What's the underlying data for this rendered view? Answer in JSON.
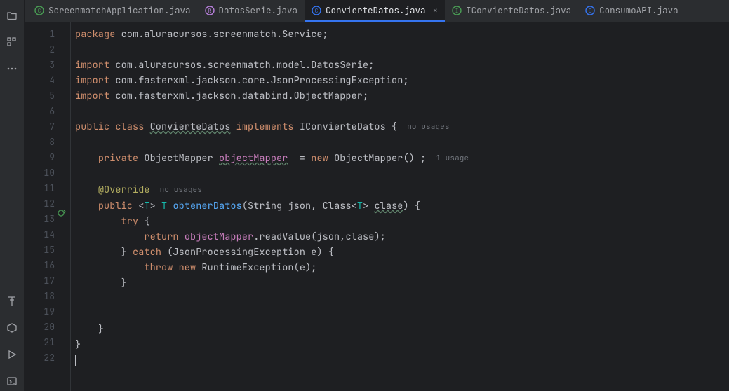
{
  "toolstrip": {
    "top": [
      "folder",
      "structure",
      "more"
    ],
    "bottom": [
      "bookmarks",
      "services",
      "run",
      "terminal"
    ]
  },
  "tabs": [
    {
      "label": "ScreenmatchApplication.java",
      "icon": "class",
      "active": false
    },
    {
      "label": "DatosSerie.java",
      "icon": "class",
      "active": false
    },
    {
      "label": "ConvierteDatos.java",
      "icon": "class",
      "active": true
    },
    {
      "label": "IConvierteDatos.java",
      "icon": "interface",
      "active": false
    },
    {
      "label": "ConsumoAPI.java",
      "icon": "class",
      "active": false
    }
  ],
  "hints": {
    "noUsages": "no usages",
    "noUsages2": "no usages",
    "oneUsage": "1 usage"
  },
  "code": {
    "l1": {
      "package": "package",
      "pkg": "com.aluracursos.screenmatch.Service;"
    },
    "l3": {
      "import": "import",
      "pkg": "com.aluracursos.screenmatch.model.DatosSerie;"
    },
    "l4": {
      "import": "import",
      "pkg": "com.fasterxml.jackson.core.JsonProcessingException;"
    },
    "l5": {
      "import": "import",
      "pkg": "com.fasterxml.jackson.databind.ObjectMapper;"
    },
    "l7": {
      "public": "public",
      "class": "class",
      "name": "ConvierteDatos",
      "implements": "implements",
      "iface": "IConvierteDatos",
      "brace": " {"
    },
    "l9": {
      "private": "private",
      "type": "ObjectMapper",
      "field": "objectMapper",
      "eq": "  = ",
      "new": "new",
      "ctor": "ObjectMapper()",
      "end": " ;"
    },
    "l11": {
      "ann": "@Override"
    },
    "l12": {
      "public": "public",
      "lt": "<",
      "T": "T",
      "gt": "> ",
      "Tret": "T",
      "method": "obtenerDatos",
      "sig1": "(String ",
      "p1": "json",
      "sig2": ", Class<",
      "Tg": "T",
      "sig3": "> ",
      "p2": "clase",
      "sig4": ") {"
    },
    "l13": {
      "try": "try",
      "brace": " {"
    },
    "l14": {
      "return": "return",
      "field": "objectMapper",
      "call": ".readValue(",
      "a1": "json",
      "c": ",",
      "a2": "clase",
      "end": ");"
    },
    "l15": {
      "cb": "} ",
      "catch": "catch",
      "sig": " (JsonProcessingException e) {"
    },
    "l16": {
      "throw": "throw",
      "new": "new",
      "exc": "RuntimeException(e);"
    },
    "l17": {
      "cb": "}"
    },
    "l20": {
      "cb": "}"
    },
    "l21": {
      "cb": "}"
    }
  },
  "lineCount": 22
}
